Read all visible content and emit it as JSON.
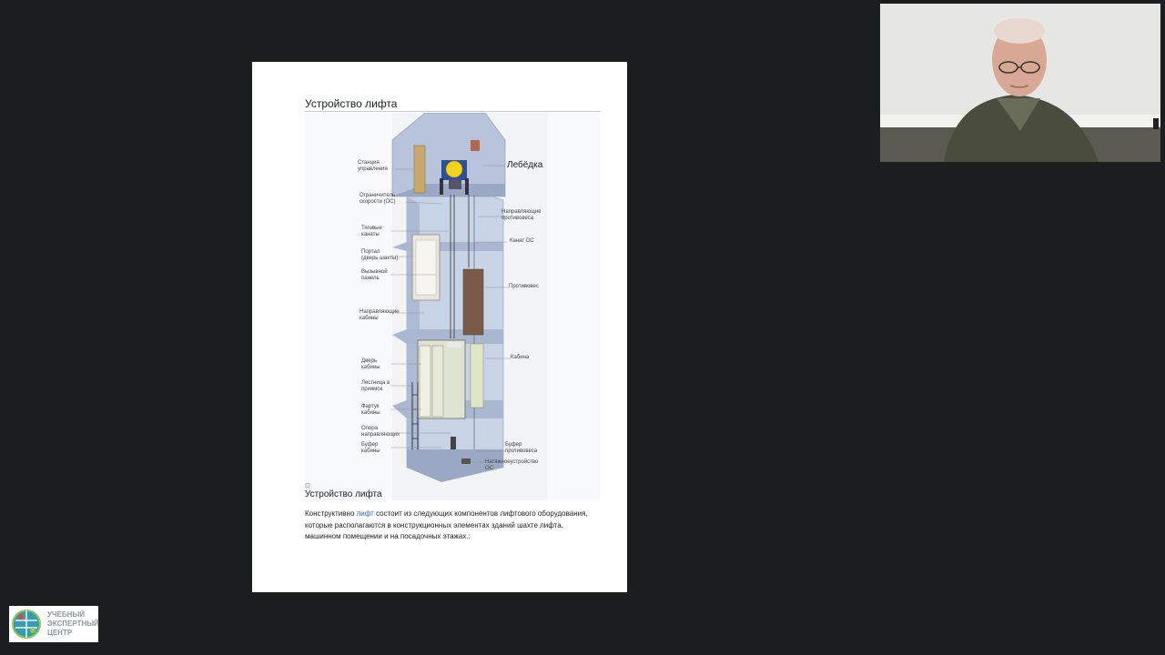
{
  "slide": {
    "title": "Устройство лифта",
    "figure_labels": {
      "winch": "Лебёдка",
      "control_station": "Станция\nуправления",
      "speed_limiter": "Ограничитель\nскорости (ОС)",
      "traction_ropes": "Тяговые\nканаты",
      "portal": "Портал\n(дверь шахты)",
      "call_panel": "Вызывной\nпанель",
      "cabin_guides": "Направляющие\nкабины",
      "cabin_door": "Дверь\nкабины",
      "pit_ladder": "Лестница в\nприямок",
      "apron": "Фартук\nкабины",
      "guide_support": "Опора\nнаправляющих",
      "cabin_buffer": "Буфер\nкабины",
      "counterweight_guides": "Направляющие\nпротивовеса",
      "limiter_rope": "Канат ОС",
      "counterweight": "Противовес",
      "cabin": "Кабина",
      "counterweight_buffer": "Буфер\nпротивовеса",
      "tensioner": "Натяжноеустройство\nОС"
    },
    "caption": "Устройство лифта",
    "caption_icon": "⊡",
    "body": {
      "before": "Конструктивно ",
      "link": "лифт",
      "after": " состоит из следующих компонентов лифтового оборудования, которые располагаются в конструкционных элементах зданий шахте лифта, машинном помещении и на посадочных этажах.:"
    }
  },
  "logo": {
    "line1": "УЧЕБНЫЙ",
    "line2": "ЭКСПЕРТНЫЙ",
    "line3": "ЦЕНТР"
  },
  "colors": {
    "background": "#1c1d1f",
    "slide": "#ffffff",
    "shaft": "#c9d3e6",
    "link": "#3366cc",
    "winch": "#f2d21a"
  }
}
